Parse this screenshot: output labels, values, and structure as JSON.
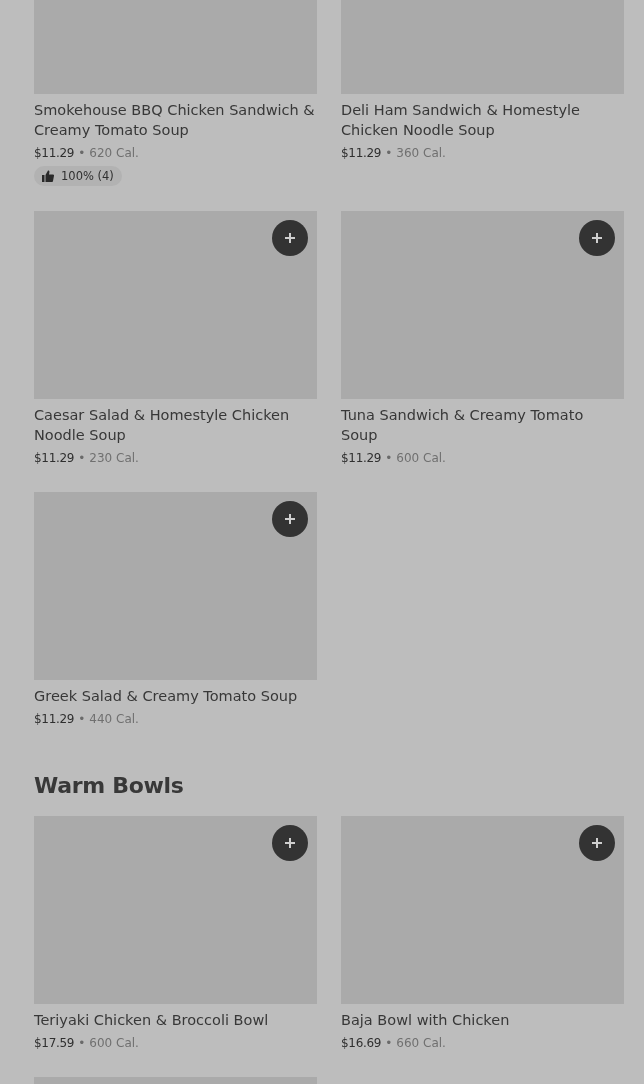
{
  "sections": [
    {
      "items": [
        {
          "kind": "dish",
          "name": "Smokehouse BBQ Chicken Sandwich & Creamy Tomato Soup",
          "price": "$11.29",
          "separator": "•",
          "calories": "620 Cal.",
          "rating": "100% (4)"
        },
        {
          "kind": "dish",
          "name": "Deli Ham Sandwich & Homestyle Chicken Noodle Soup",
          "price": "$11.29",
          "separator": "•",
          "calories": "360 Cal."
        },
        {
          "kind": "dish",
          "name": "Caesar Salad & Homestyle Chicken Noodle Soup",
          "price": "$11.29",
          "separator": "•",
          "calories": "230 Cal.",
          "add_button": true
        },
        {
          "kind": "dish",
          "name": "Tuna Sandwich & Creamy Tomato Soup",
          "price": "$11.29",
          "separator": "•",
          "calories": "600 Cal.",
          "add_button": true
        },
        {
          "kind": "dish",
          "name": "Greek Salad & Creamy Tomato Soup",
          "price": "$11.29",
          "separator": "•",
          "calories": "440 Cal.",
          "add_button": true
        }
      ]
    },
    {
      "title": "Warm Bowls",
      "items": [
        {
          "kind": "dish",
          "name": "Teriyaki Chicken & Broccoli Bowl",
          "price": "$17.59",
          "separator": "•",
          "calories": "600 Cal.",
          "add_button": true
        },
        {
          "kind": "dish",
          "name": "Baja Bowl with Chicken",
          "price": "$16.69",
          "separator": "•",
          "calories": "660 Cal.",
          "add_button": true
        },
        {
          "kind": "peek"
        }
      ]
    }
  ]
}
